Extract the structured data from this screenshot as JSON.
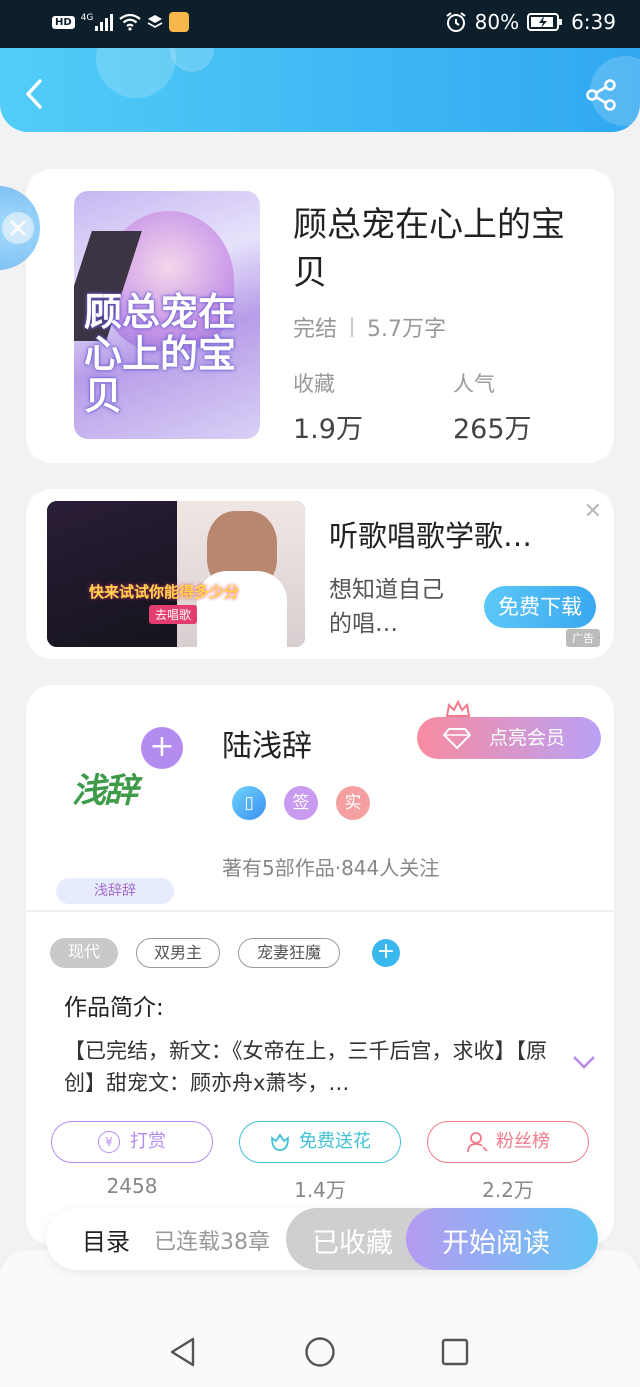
{
  "status_bar": {
    "left_icons": [
      "hd-icon",
      "signal-4g-icon",
      "wifi-icon",
      "layers-icon",
      "app-cat-icon"
    ],
    "left_labels": {
      "hd": "HD",
      "net": "4G"
    },
    "battery_percent": "80%",
    "time": "6:39"
  },
  "header": {
    "back_icon": "chevron-left-icon",
    "share_icon": "share-icon"
  },
  "book": {
    "cover_text": "顾总宠在心上的宝贝",
    "title": "顾总宠在心上的宝贝",
    "status": "完结",
    "word_count": "5.7万字",
    "favorites_label": "收藏",
    "favorites_value": "1.9万",
    "popularity_label": "人气",
    "popularity_value": "265万"
  },
  "ad": {
    "image_caption": "快来试试你能得多少分",
    "image_button": "去唱歌",
    "title": "听歌唱歌学歌…",
    "description": "想知道自己的唱…",
    "button": "免费下载",
    "mark": "广告"
  },
  "author": {
    "avatar_text": "浅辞",
    "avatar_tag": "浅辞辞",
    "name": "陆浅辞",
    "vip_button": "点亮会员",
    "badges": [
      "签",
      "实"
    ],
    "stats": "著有5部作品·844人关注"
  },
  "tags": [
    "现代",
    "双男主",
    "宠妻狂魔"
  ],
  "intro": {
    "heading": "作品简介:",
    "text": "【已完结，新文：《女帝在上，三千后宫，求收】【原创】甜宠文：顾亦舟x萧岑，…"
  },
  "actions": [
    {
      "label": "打赏",
      "count": "2458"
    },
    {
      "label": "免费送花",
      "count": "1.4万"
    },
    {
      "label": "粉丝榜",
      "count": "2.2万"
    }
  ],
  "bottom_bar": {
    "catalog": "目录",
    "chapters": "已连载38章",
    "favorited": "已收藏",
    "start_reading": "开始阅读"
  },
  "colors": {
    "accent": "#3aa8ef",
    "purple": "#b48cf0",
    "pink": "#f27a8c",
    "teal": "#41c2d6"
  }
}
